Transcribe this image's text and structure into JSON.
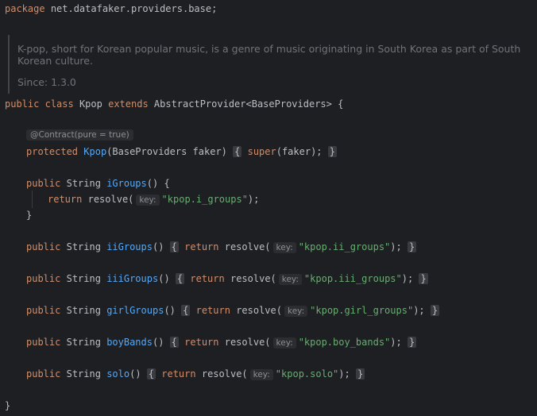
{
  "package_line": {
    "kw": "package",
    "name": "net.datafaker.providers.base;"
  },
  "doc": {
    "text": "K-pop, short for Korean popular music, is a genre of music originating in South Korea as part of South Korean culture.",
    "since": "Since: 1.3.0"
  },
  "class_decl": {
    "kw_public": "public",
    "kw_class": "class",
    "name": "Kpop",
    "kw_extends": "extends",
    "super": "AbstractProvider<BaseProviders>",
    "brace": "{"
  },
  "annotation": "@Contract(pure = true)",
  "constructor": {
    "kw": "protected",
    "name": "Kpop",
    "params": "(BaseProviders faker)",
    "body_open": "{",
    "super_kw": "super",
    "super_args": "(faker);",
    "body_close": "}"
  },
  "common": {
    "kw_public": "public",
    "type": "String",
    "ret": "return",
    "call": "resolve(",
    "hint": "key:",
    "end": ");",
    "close": "}",
    "open": "{"
  },
  "methods": [
    {
      "name": "iGroups",
      "key": "\"kpop.i_groups\""
    },
    {
      "name": "iiGroups",
      "key": "\"kpop.ii_groups\""
    },
    {
      "name": "iiiGroups",
      "key": "\"kpop.iii_groups\""
    },
    {
      "name": "girlGroups",
      "key": "\"kpop.girl_groups\""
    },
    {
      "name": "boyBands",
      "key": "\"kpop.boy_bands\""
    },
    {
      "name": "solo",
      "key": "\"kpop.solo\""
    }
  ],
  "class_close": "}"
}
